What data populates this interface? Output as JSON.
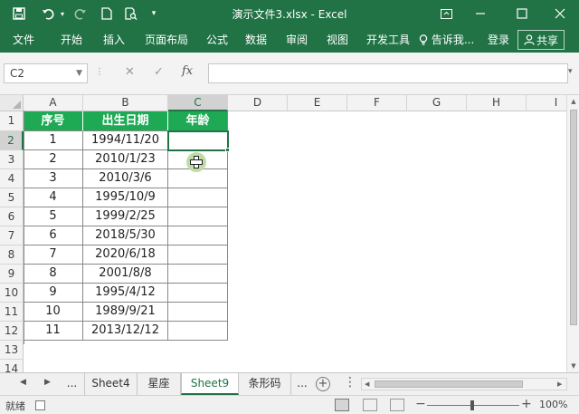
{
  "window": {
    "title": "演示文件3.xlsx - Excel",
    "quick_access": [
      "save-icon",
      "undo-icon",
      "redo-icon",
      "new-file-icon",
      "print-preview-icon",
      "customize-dropdown-icon"
    ],
    "controls": [
      "ribbon-options-icon",
      "minimize-icon",
      "maximize-icon",
      "close-icon"
    ]
  },
  "ribbon": {
    "tabs": [
      "文件",
      "开始",
      "插入",
      "页面布局",
      "公式",
      "数据",
      "审阅",
      "视图",
      "开发工具"
    ],
    "tell_me": "告诉我...",
    "login": "登录",
    "share": "共享"
  },
  "formula_bar": {
    "name_box": "C2",
    "cancel": "✕",
    "enter": "✓",
    "fx": "fx",
    "content": ""
  },
  "grid": {
    "columns": [
      "A",
      "B",
      "C",
      "D",
      "E",
      "F",
      "G",
      "H",
      "I"
    ],
    "rows": [
      "1",
      "2",
      "3",
      "4",
      "5",
      "6",
      "7",
      "8",
      "9",
      "10",
      "11",
      "12",
      "13",
      "14"
    ],
    "selected_column": "C",
    "selected_row": "2",
    "table": {
      "headers": [
        "序号",
        "出生日期",
        "年龄"
      ],
      "rows": [
        [
          "1",
          "1994/11/20",
          ""
        ],
        [
          "2",
          "2010/1/23",
          ""
        ],
        [
          "3",
          "2010/3/6",
          ""
        ],
        [
          "4",
          "1995/10/9",
          ""
        ],
        [
          "5",
          "1999/2/25",
          ""
        ],
        [
          "6",
          "2018/5/30",
          ""
        ],
        [
          "7",
          "2020/6/18",
          ""
        ],
        [
          "8",
          "2001/8/8",
          ""
        ],
        [
          "9",
          "1995/4/12",
          ""
        ],
        [
          "10",
          "1989/9/21",
          ""
        ],
        [
          "11",
          "2013/12/12",
          ""
        ]
      ]
    }
  },
  "sheet_tabs": {
    "tabs": [
      "...",
      "Sheet4",
      "星座",
      "Sheet9",
      "条形码",
      "..."
    ],
    "active": "Sheet9"
  },
  "status_bar": {
    "status": "就绪",
    "zoom": "100%"
  },
  "colors": {
    "excel_green": "#217346",
    "table_header_fill": "#1eaa55"
  }
}
